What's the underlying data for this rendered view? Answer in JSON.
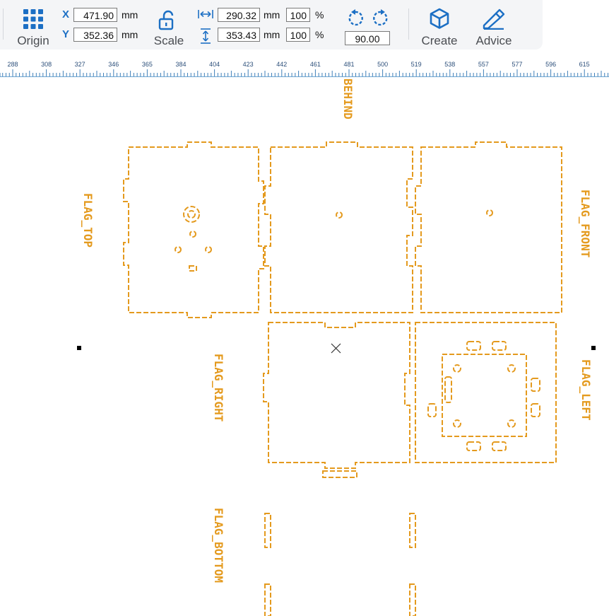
{
  "toolbar": {
    "origin_label": "Origin",
    "scale_label": "Scale",
    "create_label": "Create",
    "advice_label": "Advice",
    "x_label": "X",
    "y_label": "Y",
    "x_value": "471.90",
    "y_value": "352.36",
    "mm": "mm",
    "width_value": "290.32",
    "height_value": "353.43",
    "width_pct": "100",
    "height_pct": "100",
    "percent": "%",
    "rotation_value": "90.00"
  },
  "ruler": {
    "ticks": [
      "288",
      "308",
      "327",
      "346",
      "365",
      "384",
      "404",
      "423",
      "442",
      "461",
      "481",
      "500",
      "519",
      "538",
      "557",
      "577",
      "596",
      "615"
    ]
  },
  "canvas": {
    "labels": {
      "behind": "BEHIND",
      "top": "FLAG_TOP",
      "front": "FLAG_FRONT",
      "right": "FLAG_RIGHT",
      "left": "FLAG_LEFT",
      "bottom": "FLAG_BOTTOM"
    }
  },
  "colors": {
    "accent": "#1c6fc4",
    "cut_line": "#e49a1e"
  }
}
